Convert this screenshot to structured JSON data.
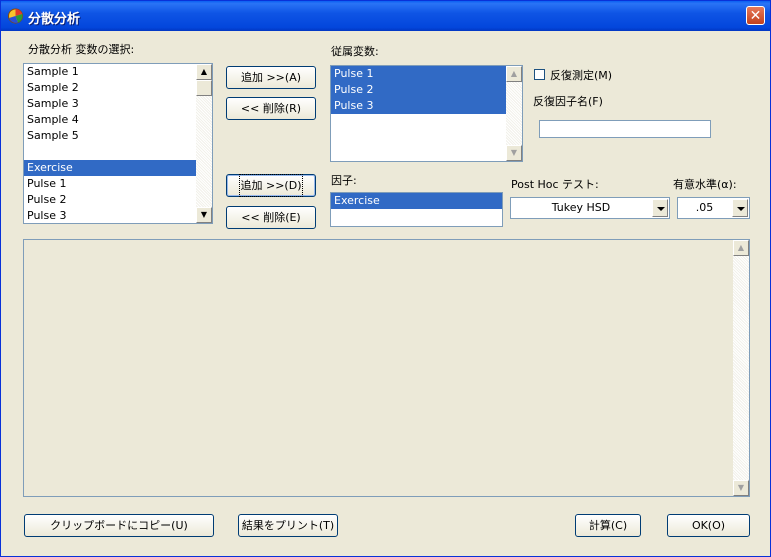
{
  "window": {
    "title": "分散分析",
    "close_glyph": "✕"
  },
  "left": {
    "label": "分散分析 変数の選択:",
    "items": [
      "Sample 1",
      "Sample 2",
      "Sample 3",
      "Sample 4",
      "Sample 5",
      "",
      "Exercise",
      "Pulse 1",
      "Pulse 2",
      "Pulse 3"
    ],
    "selected_index": 6
  },
  "buttons": {
    "add1": "追加 >>(A)",
    "remove1": "<< 削除(R)",
    "add2": "追加 >>(D)",
    "remove2": "<< 削除(E)",
    "copy": "クリップボードにコピー(U)",
    "print": "結果をプリント(T)",
    "calc": "計算(C)",
    "ok": "OK(O)"
  },
  "dependent": {
    "label": "従属変数:",
    "items": [
      "Pulse 1",
      "Pulse 2",
      "Pulse 3"
    ]
  },
  "repeated": {
    "checkbox_label": "反復測定(M)",
    "checked": false,
    "factor_label": "反復因子名(F)",
    "factor_value": ""
  },
  "factor": {
    "label": "因子:",
    "items": [
      "Exercise"
    ]
  },
  "posthoc": {
    "label": "Post Hoc テスト:",
    "value": "Tukey HSD"
  },
  "alpha": {
    "label": "有意水準(α):",
    "value": ".05"
  },
  "scroll_glyphs": {
    "up": "▲",
    "down": "▼"
  }
}
